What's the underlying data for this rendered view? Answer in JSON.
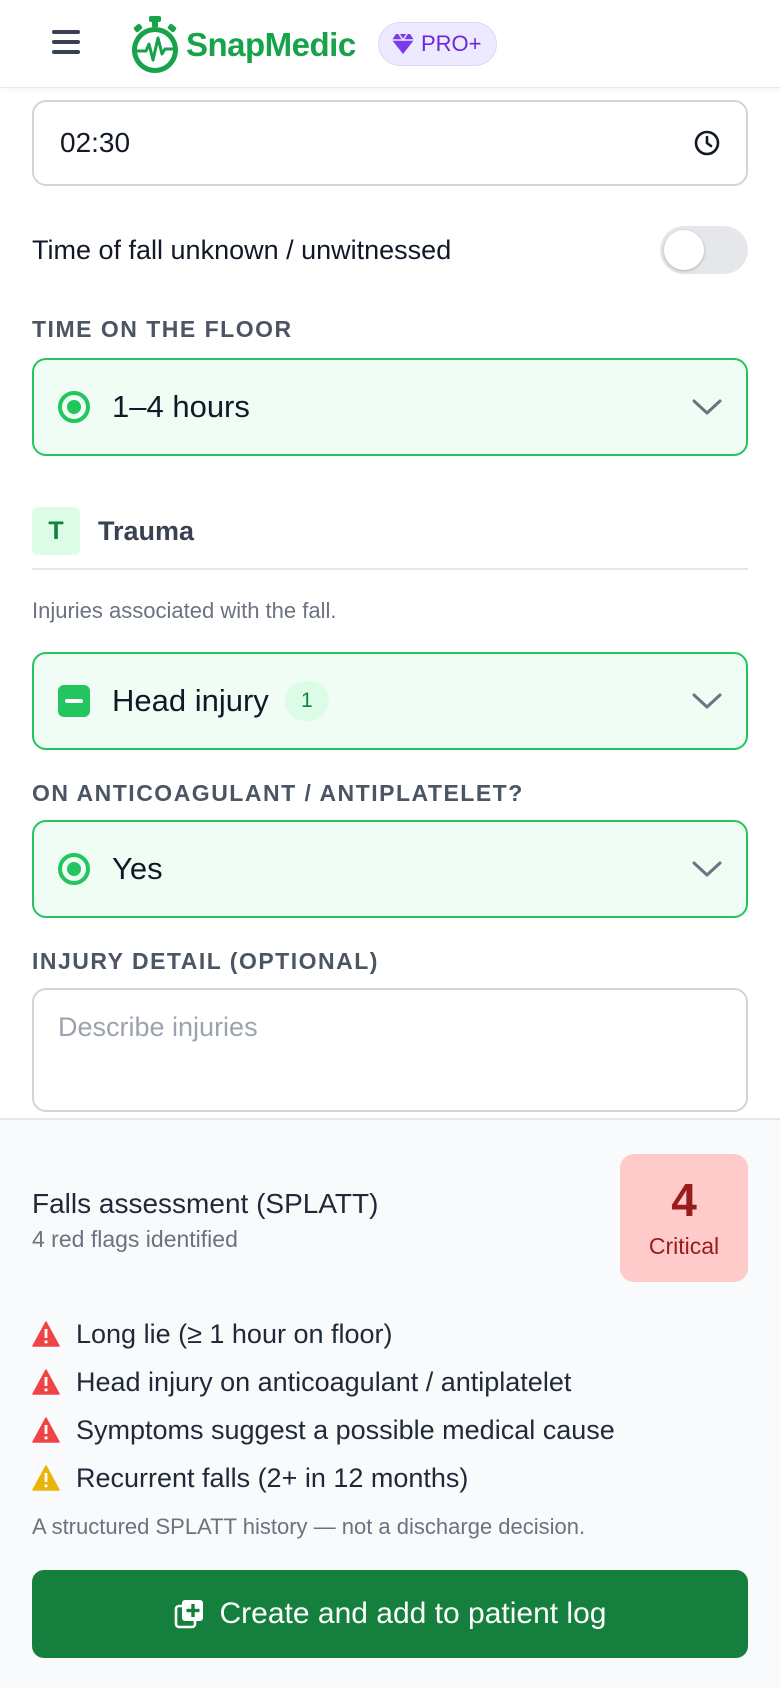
{
  "header": {
    "menu_icon": "hamburger-menu-icon",
    "brand": "SnapMedic",
    "pro_badge": "PRO+",
    "brand_color": "#16a34a",
    "pro_color": "#6d28d9"
  },
  "form": {
    "time_value": "02:30",
    "time_unknown_label": "Time of fall unknown / unwitnessed",
    "time_unknown_on": false,
    "time_on_floor_label": "TIME ON THE FLOOR",
    "time_on_floor_value": "1–4 hours",
    "trauma": {
      "chip": "T",
      "title": "Trauma",
      "description": "Injuries associated with the fall."
    },
    "injury_select_value": "Head injury",
    "injury_count": "1",
    "anticoag_label": "ON ANTICOAGULANT / ANTIPLATELET?",
    "anticoag_value": "Yes",
    "injury_detail_label": "INJURY DETAIL (OPTIONAL)",
    "injury_detail_placeholder": "Describe injuries",
    "injury_detail_value": ""
  },
  "assessment": {
    "title": "Falls assessment (SPLATT)",
    "subtitle": "4 red flags identified",
    "score": "4",
    "score_label": "Critical",
    "score_color": "#991b1b",
    "flags": [
      {
        "text": "Long lie (≥ 1 hour on floor)",
        "severity": "red"
      },
      {
        "text": "Head injury on anticoagulant / antiplatelet",
        "severity": "red"
      },
      {
        "text": "Symptoms suggest a possible medical cause",
        "severity": "red"
      },
      {
        "text": "Recurrent falls (2+ in 12 months)",
        "severity": "amber"
      }
    ],
    "disclaimer": "A structured SPLATT history — not a discharge decision.",
    "cta_label": "Create and add to patient log"
  }
}
